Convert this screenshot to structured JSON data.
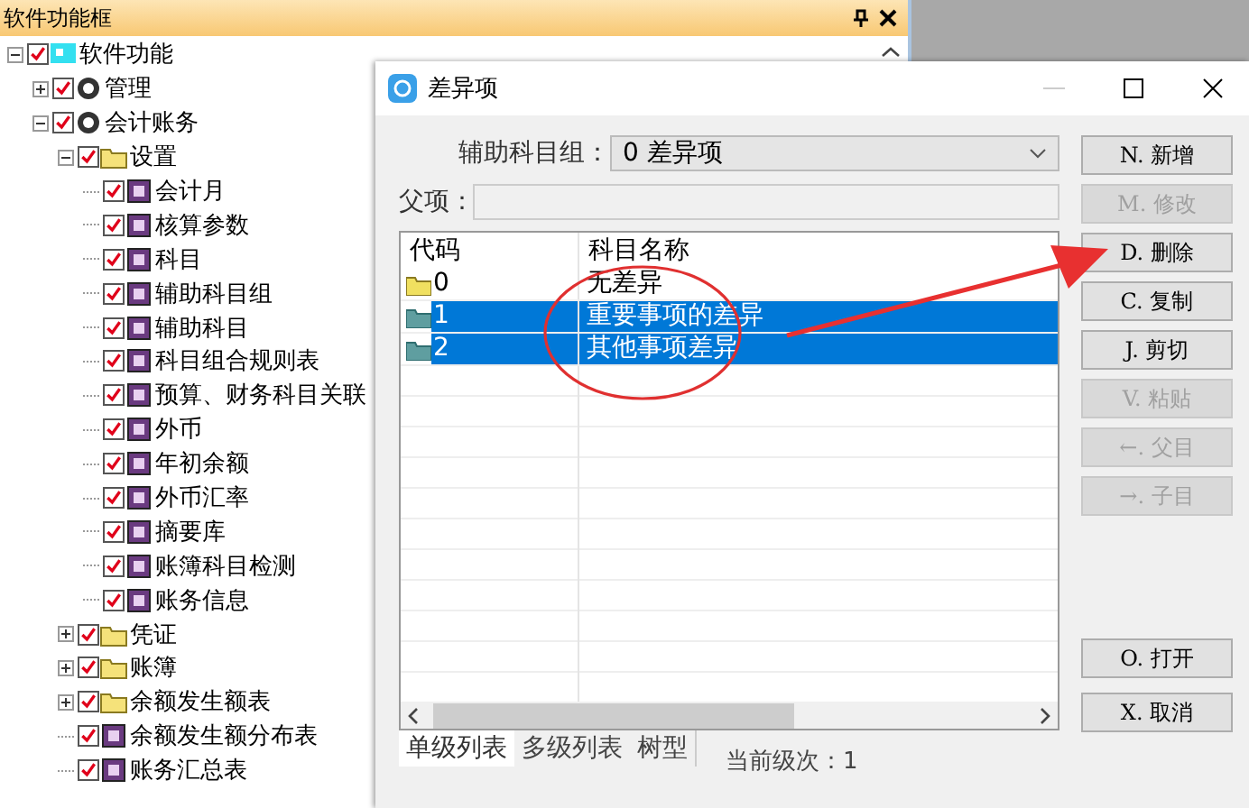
{
  "side_panel": {
    "title": "软件功能框",
    "tree": [
      {
        "label": "软件功能",
        "kind": "root",
        "checked": true,
        "expanded": true,
        "children": [
          {
            "label": "管理",
            "kind": "module",
            "checked": true,
            "expanded": false
          },
          {
            "label": "会计账务",
            "kind": "module",
            "checked": true,
            "expanded": true,
            "children": [
              {
                "label": "设置",
                "kind": "folder",
                "checked": true,
                "expanded": true,
                "children": [
                  {
                    "label": "会计月",
                    "kind": "leaf",
                    "checked": true
                  },
                  {
                    "label": "核算参数",
                    "kind": "leaf",
                    "checked": true
                  },
                  {
                    "label": "科目",
                    "kind": "leaf",
                    "checked": true
                  },
                  {
                    "label": "辅助科目组",
                    "kind": "leaf",
                    "checked": true
                  },
                  {
                    "label": "辅助科目",
                    "kind": "leaf",
                    "checked": true
                  },
                  {
                    "label": "科目组合规则表",
                    "kind": "leaf",
                    "checked": true
                  },
                  {
                    "label": "预算、财务科目关联",
                    "kind": "leaf",
                    "checked": true
                  },
                  {
                    "label": "外币",
                    "kind": "leaf",
                    "checked": true
                  },
                  {
                    "label": "年初余额",
                    "kind": "leaf",
                    "checked": true
                  },
                  {
                    "label": "外币汇率",
                    "kind": "leaf",
                    "checked": true
                  },
                  {
                    "label": "摘要库",
                    "kind": "leaf",
                    "checked": true
                  },
                  {
                    "label": "账簿科目检测",
                    "kind": "leaf",
                    "checked": true
                  },
                  {
                    "label": "账务信息",
                    "kind": "leaf",
                    "checked": true
                  }
                ]
              },
              {
                "label": "凭证",
                "kind": "folder",
                "checked": true,
                "expanded": false
              },
              {
                "label": "账簿",
                "kind": "folder",
                "checked": true,
                "expanded": false
              },
              {
                "label": "余额发生额表",
                "kind": "folder",
                "checked": true,
                "expanded": false
              },
              {
                "label": "余额发生额分布表",
                "kind": "leaf",
                "checked": true
              },
              {
                "label": "账务汇总表",
                "kind": "leaf",
                "checked": true
              }
            ]
          }
        ]
      }
    ]
  },
  "dialog": {
    "title": "差异项",
    "group_label": "辅助科目组：",
    "group_value": "0 差异项",
    "parent_label": "父项：",
    "columns": [
      "代码",
      "科目名称"
    ],
    "rows": [
      {
        "code": "0",
        "name": "无差异",
        "selected": false
      },
      {
        "code": "1",
        "name": "重要事项的差异",
        "selected": true
      },
      {
        "code": "2",
        "name": "其他事项差异",
        "selected": true
      }
    ],
    "tabs": [
      {
        "label": "单级列表",
        "selected": true
      },
      {
        "label": "多级列表",
        "selected": false
      },
      {
        "label": "树型",
        "selected": false
      }
    ],
    "level_text": "当前级次：1",
    "buttons": [
      {
        "label": "N. 新增",
        "disabled": false
      },
      {
        "label": "M. 修改",
        "disabled": true
      },
      {
        "label": "D. 删除",
        "disabled": false
      },
      {
        "label": "C. 复制",
        "disabled": false
      },
      {
        "label": "J. 剪切",
        "disabled": false
      },
      {
        "label": "V. 粘贴",
        "disabled": true
      },
      {
        "label": "←. 父目",
        "disabled": true
      },
      {
        "label": "→. 子目",
        "disabled": true
      }
    ],
    "bottom_buttons": [
      {
        "label": "O. 打开",
        "disabled": false
      },
      {
        "label": "X. 取消",
        "disabled": false
      }
    ]
  }
}
